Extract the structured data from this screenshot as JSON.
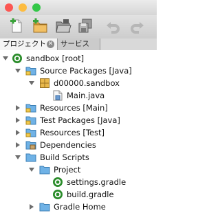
{
  "tabs": {
    "projects": "プロジェクト",
    "services": "サービス"
  },
  "tree": {
    "root": "sandbox [root]",
    "source_packages": "Source Packages [Java]",
    "package": "d00000.sandbox",
    "main_java": "Main.java",
    "resources_main": "Resources [Main]",
    "test_packages": "Test Packages [Java]",
    "resources_test": "Resources [Test]",
    "dependencies": "Dependencies",
    "build_scripts": "Build Scripts",
    "project": "Project",
    "settings_gradle": "settings.gradle",
    "build_gradle": "build.gradle",
    "gradle_home": "Gradle Home"
  },
  "colors": {
    "close": "#fc5753",
    "minimize": "#fdbc40",
    "zoom": "#33c748",
    "folder": "#6fb2e6",
    "gradle": "#2a8c2a"
  },
  "icons": {
    "new_file": "new-file-icon",
    "new_project": "new-project-icon",
    "open_project": "open-project-icon",
    "save_all": "save-all-icon",
    "undo": "undo-icon",
    "redo": "redo-icon"
  }
}
